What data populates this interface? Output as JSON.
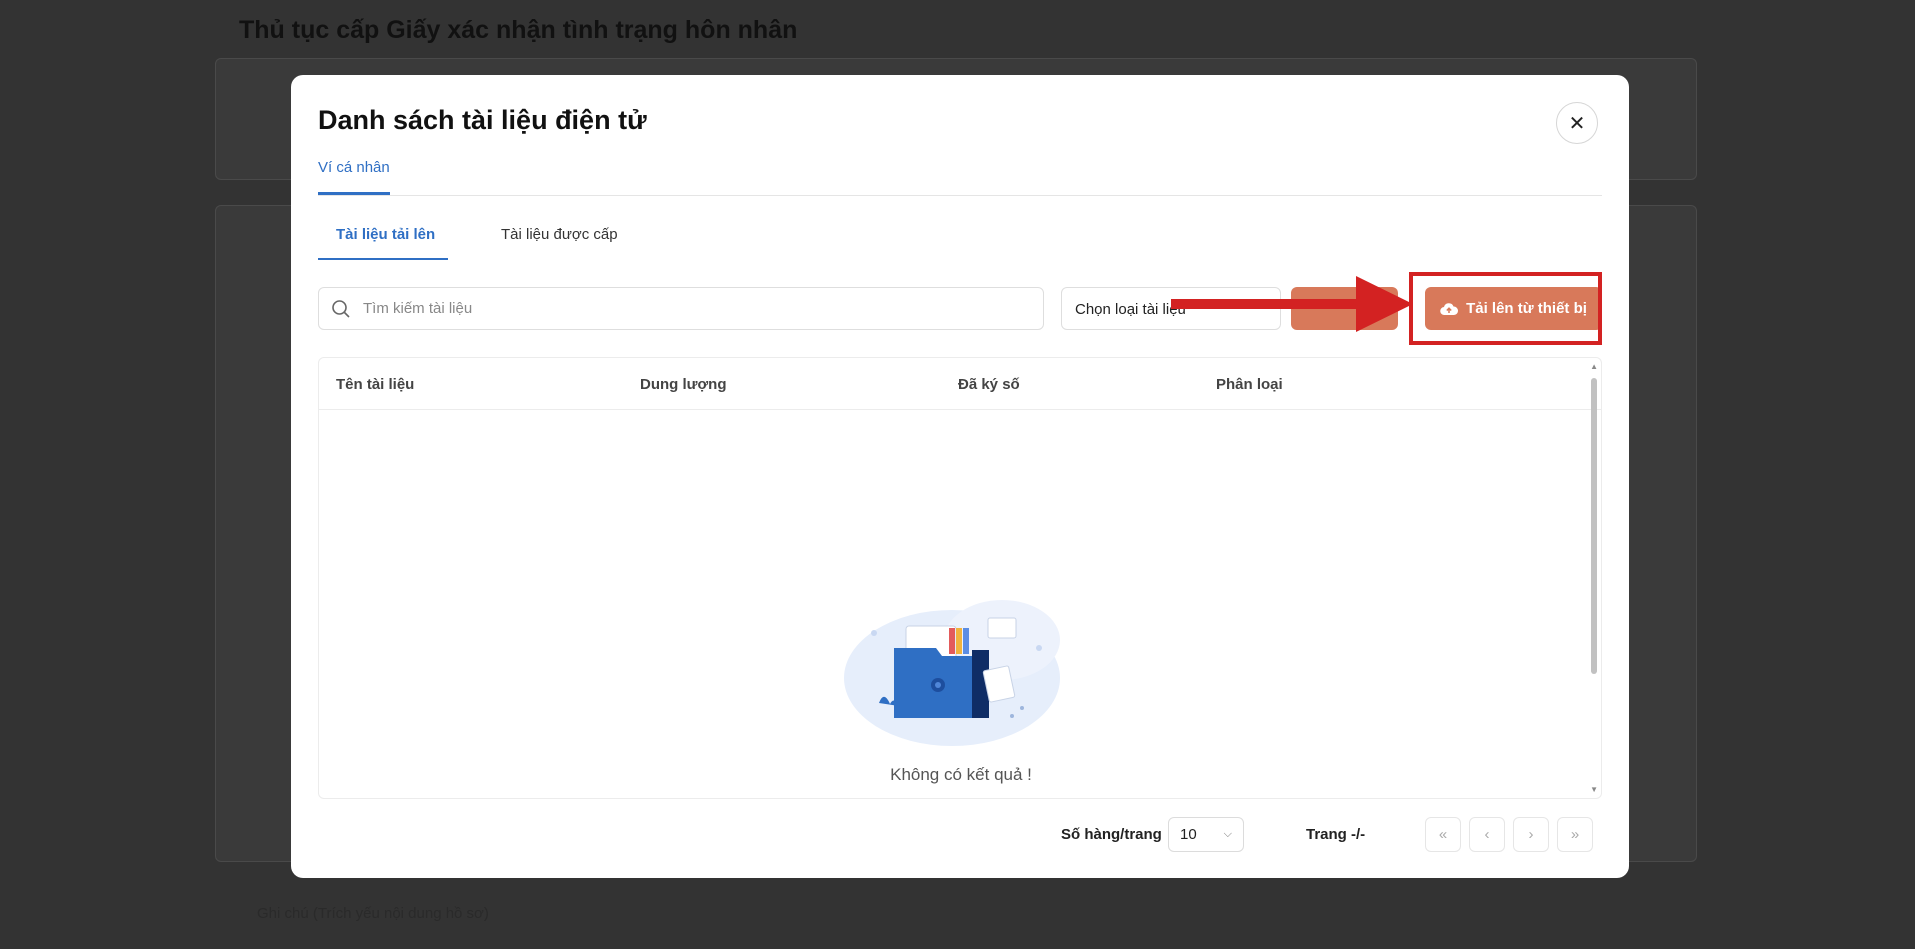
{
  "page": {
    "title": "Thủ tục cấp Giấy xác nhận tình trạng hôn nhân",
    "note_label": "Ghi chú (Trích yếu nội dung hồ sơ)"
  },
  "modal": {
    "title": "Danh sách tài liệu điện tử",
    "close_icon": "close-icon",
    "wallet_tab": "Ví cá nhân",
    "tabs": [
      {
        "label": "Tài liệu tải lên",
        "active": true
      },
      {
        "label": "Tài liệu được cấp",
        "active": false
      }
    ],
    "search_placeholder": "Tìm kiếm tài liệu",
    "type_select_label": "Chọn loại tài liệu",
    "upload_button": "Tải lên từ thiết bị",
    "table_headers": [
      "Tên tài liệu",
      "Dung lượng",
      "Đã ký số",
      "Phân loại"
    ],
    "empty_text": "Không có kết quả !",
    "rows_per_page_label": "Số hàng/trang",
    "rows_per_page_value": "10",
    "page_indicator": "Trang -/-",
    "pager": {
      "first": "«",
      "prev": "‹",
      "next": "›",
      "last": "»"
    }
  },
  "colors": {
    "accent": "#2f6fc4",
    "button": "#d8795a",
    "highlight": "#d32222"
  }
}
